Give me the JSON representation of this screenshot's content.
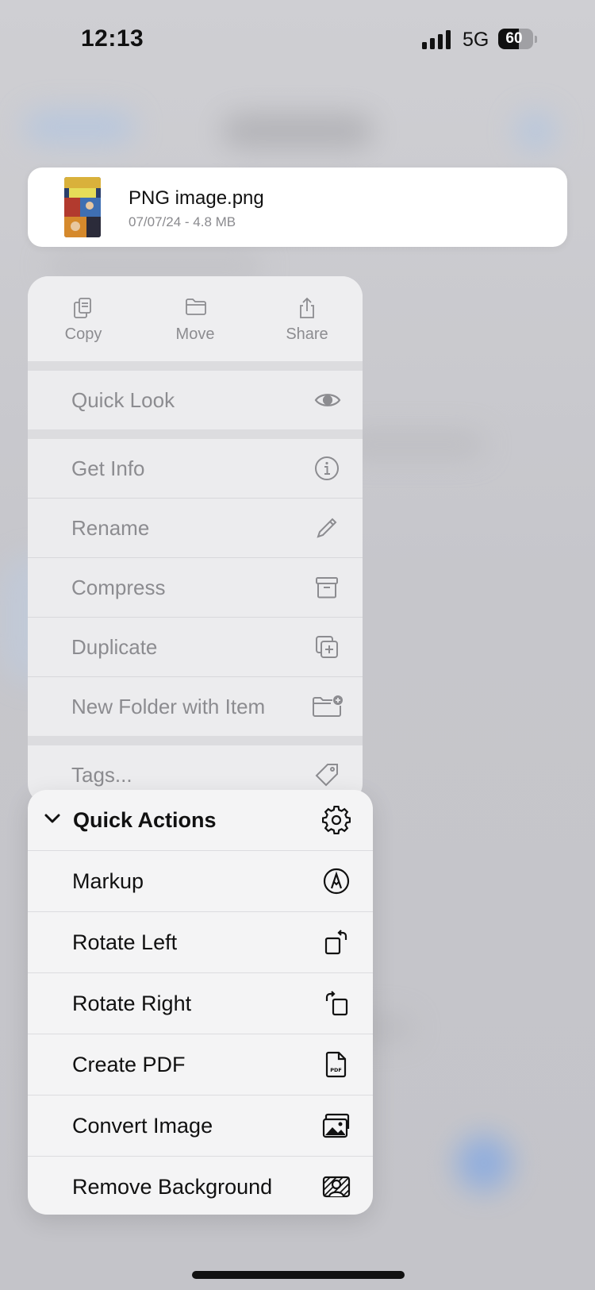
{
  "status_bar": {
    "time": "12:13",
    "network": "5G",
    "battery_level": "60",
    "battery_fraction": 0.6
  },
  "file": {
    "name": "PNG image.png",
    "meta": "07/07/24 - 4.8 MB"
  },
  "menu": {
    "actions": [
      {
        "label": "Copy",
        "icon": "copy-icon"
      },
      {
        "label": "Move",
        "icon": "folder-icon"
      },
      {
        "label": "Share",
        "icon": "share-icon"
      }
    ],
    "items": [
      {
        "label": "Quick Look",
        "icon": "eye-icon"
      },
      {
        "label": "Get Info",
        "icon": "info-icon"
      },
      {
        "label": "Rename",
        "icon": "pencil-icon"
      },
      {
        "label": "Compress",
        "icon": "archive-box-icon"
      },
      {
        "label": "Duplicate",
        "icon": "duplicate-icon"
      },
      {
        "label": "New Folder with Item",
        "icon": "folder-badge-plus-icon"
      },
      {
        "label": "Tags...",
        "icon": "tag-icon"
      }
    ]
  },
  "quick_actions": {
    "title": "Quick Actions",
    "title_icon": "gear-icon",
    "items": [
      {
        "label": "Markup",
        "icon": "markup-pen-icon"
      },
      {
        "label": "Rotate Left",
        "icon": "rotate-left-icon"
      },
      {
        "label": "Rotate Right",
        "icon": "rotate-right-icon"
      },
      {
        "label": "Create PDF",
        "icon": "pdf-document-icon"
      },
      {
        "label": "Convert Image",
        "icon": "photo-stack-icon"
      },
      {
        "label": "Remove Background",
        "icon": "remove-background-icon"
      }
    ]
  },
  "colors": {
    "dimmed_text": "#8c8c90",
    "primary_text": "#111111",
    "card_background": "#ffffff",
    "menu_background": "#ececee",
    "submenu_background": "#f4f4f5"
  }
}
